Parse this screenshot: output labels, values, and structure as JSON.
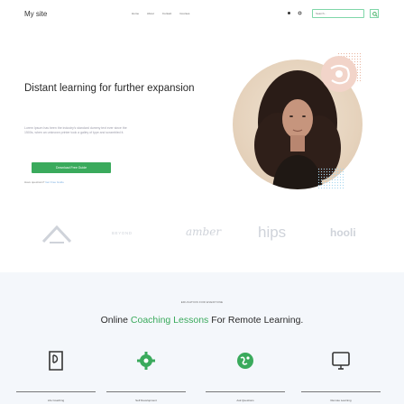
{
  "header": {
    "brand": "My site",
    "nav": [
      "Home",
      "About",
      "Contact",
      "Courses"
    ],
    "icons": [
      "eye-icon",
      "moon-icon"
    ],
    "search": {
      "placeholder": "Search..."
    },
    "search_icon": "search-icon"
  },
  "hero": {
    "title": "Distant learning for further expansion",
    "description": "Lorem Ipsum has been the industry's standard dummy text ever since the 1500s, when an unknown printer took a galley of type and scrambled it.",
    "cta_label": "Download Free Guide",
    "help_prefix": "Have questions?",
    "help_link": "Get Free Guide",
    "photo": "student-portrait"
  },
  "logos": [
    "triangle-logo",
    "BEYOND",
    "amber",
    "hips",
    "hooli"
  ],
  "courses": {
    "eyebrow": "EDUCATION FOR EVERYONE",
    "headline_start": "Online",
    "headline_accent": "Coaching Lessons",
    "headline_end": "For Remote Learning.",
    "features": [
      {
        "icon": "book-icon",
        "label": "Life Coaching"
      },
      {
        "icon": "gear-icon",
        "label": "Self Development"
      },
      {
        "icon": "globe-icon",
        "label": "Ask Questions"
      },
      {
        "icon": "monitor-icon",
        "label": "Remote Learning"
      }
    ]
  },
  "colors": {
    "accent": "#3aaa5c",
    "search_border": "#7fd6a8",
    "section_bg": "#f4f7fb",
    "logo_grey": "#cfd3da"
  }
}
